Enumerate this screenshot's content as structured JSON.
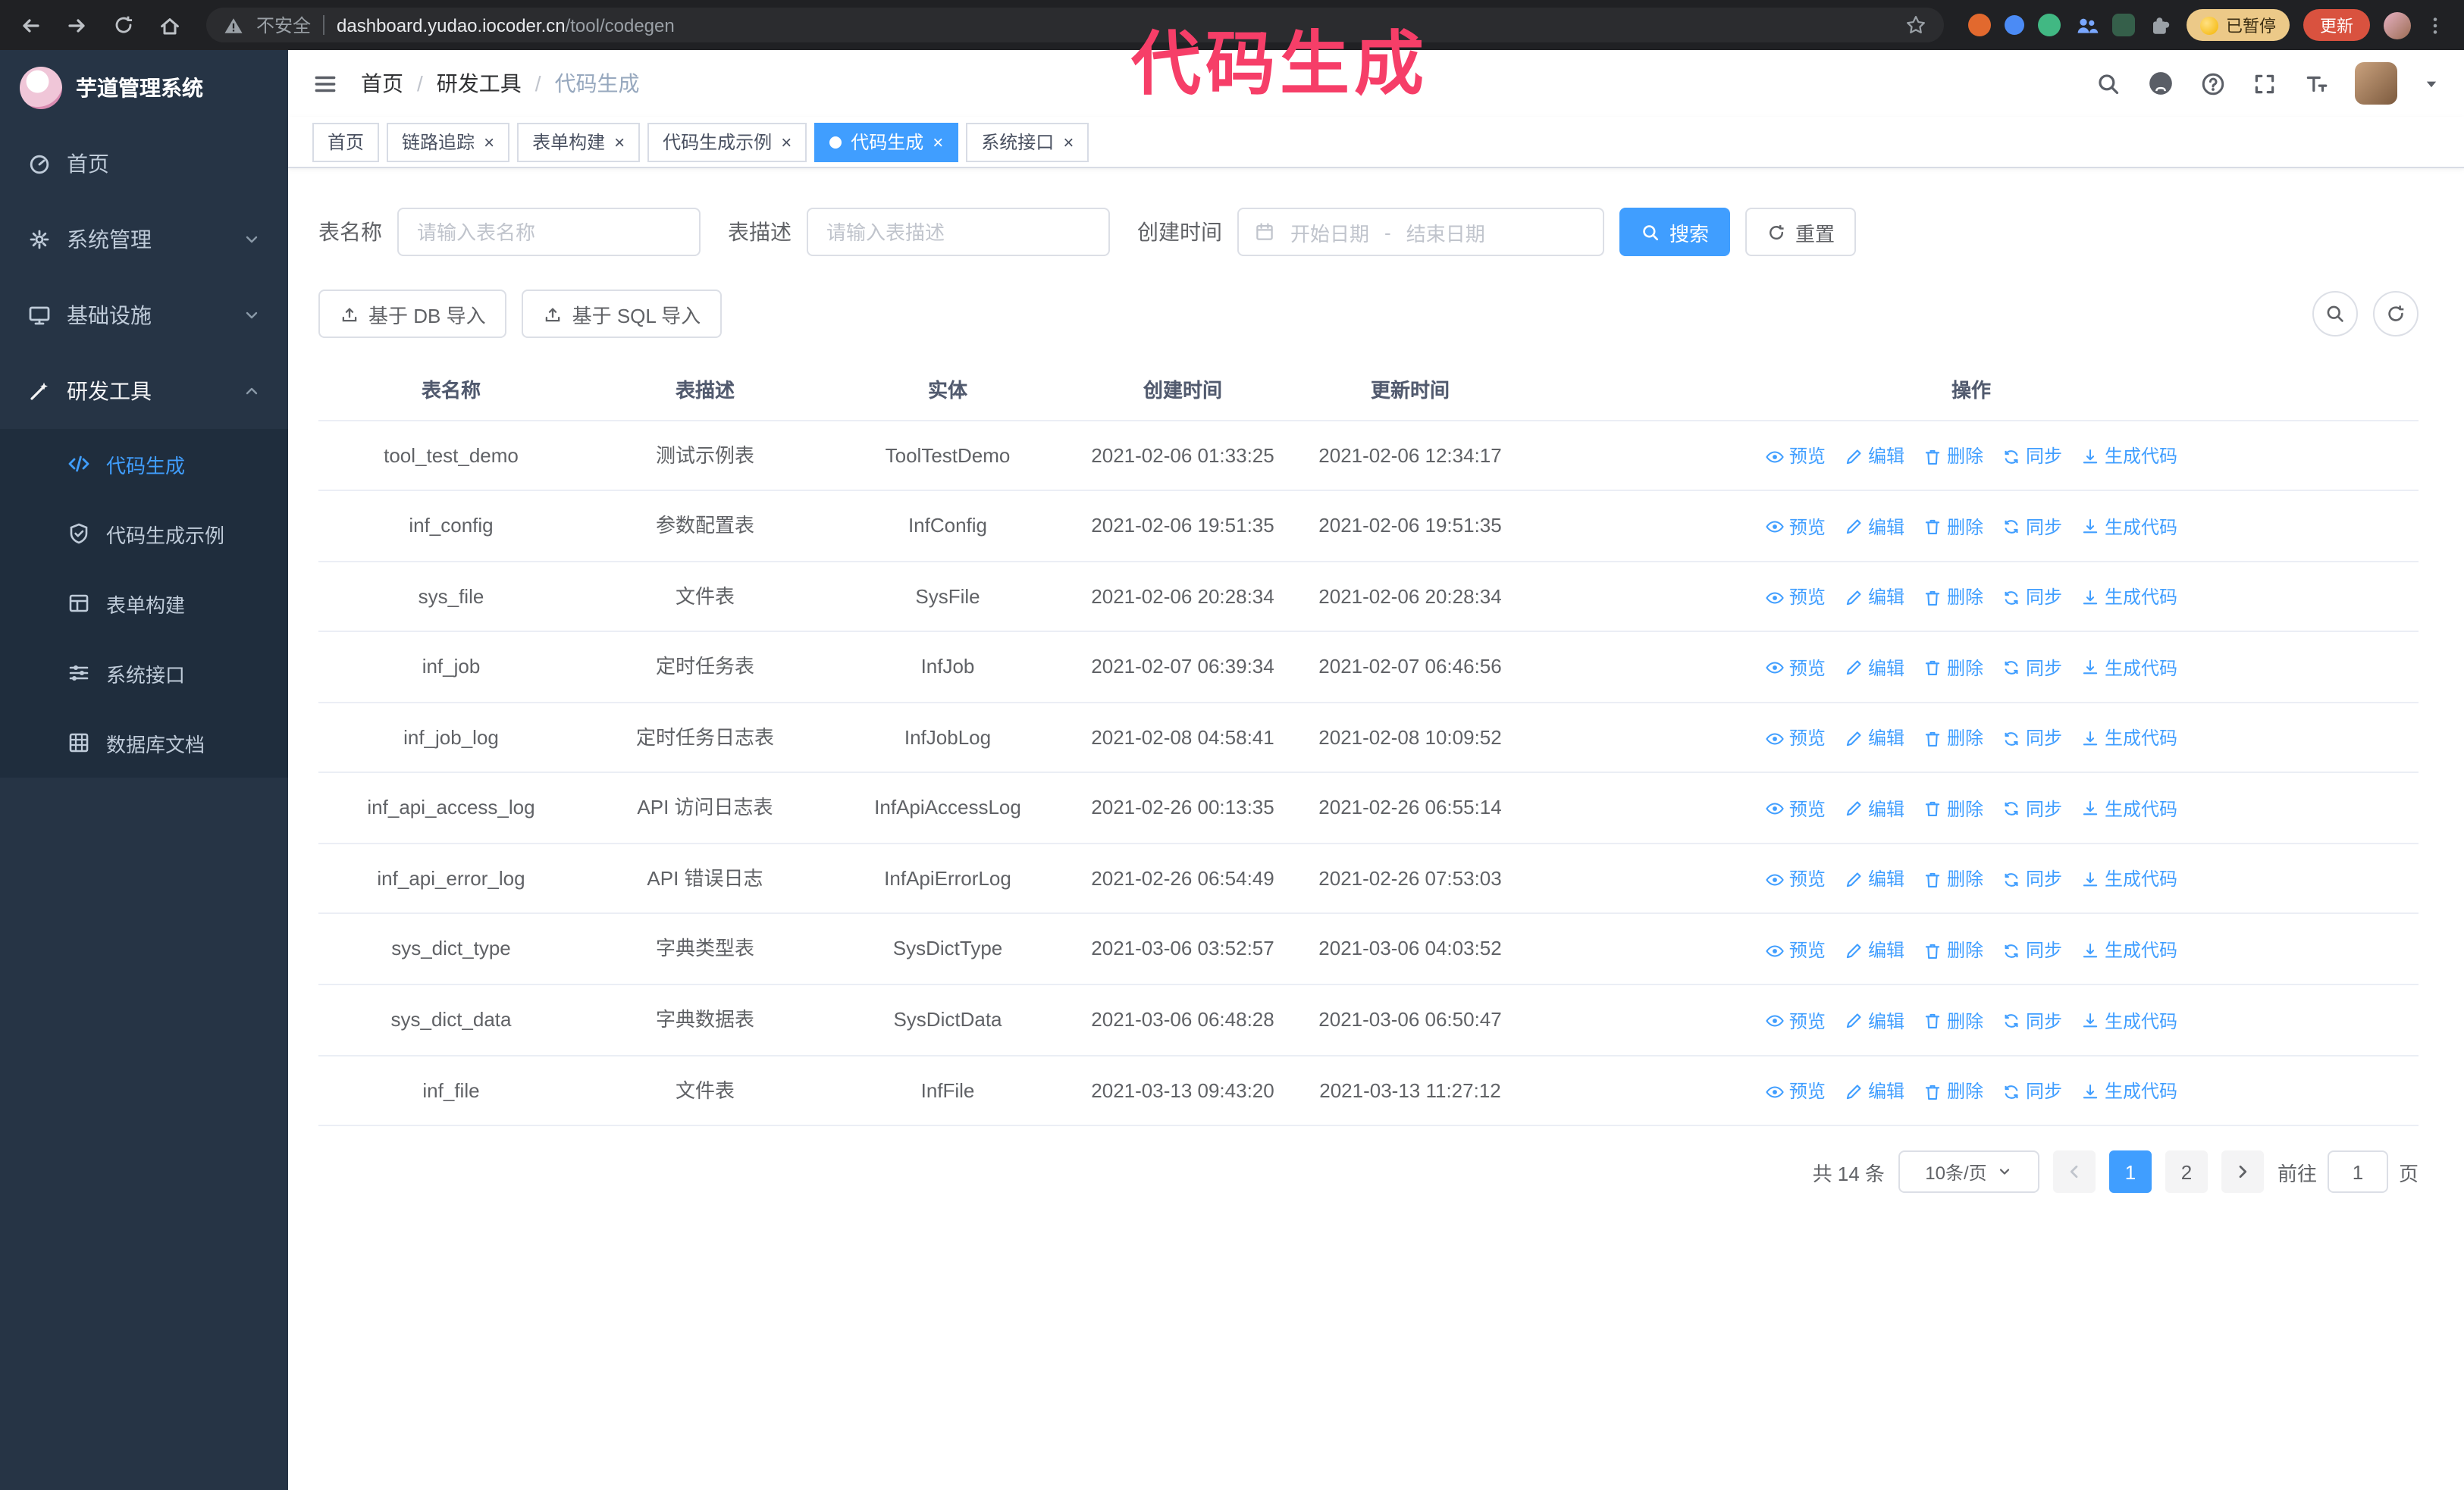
{
  "annotation": {
    "text": "代码生成"
  },
  "browser": {
    "security_label": "不安全",
    "url_domain": "dashboard.yudao.iocoder.cn",
    "url_path": "/tool/codegen",
    "paused_badge": "已暂停",
    "update_button": "更新"
  },
  "sidebar": {
    "logo_title": "芋道管理系统",
    "items": [
      {
        "label": "首页",
        "icon": "dashboard-icon",
        "expandable": false
      },
      {
        "label": "系统管理",
        "icon": "gear-icon",
        "expandable": true,
        "expanded": false
      },
      {
        "label": "基础设施",
        "icon": "monitor-icon",
        "expandable": true,
        "expanded": false
      },
      {
        "label": "研发工具",
        "icon": "tool-icon",
        "expandable": true,
        "expanded": true
      }
    ],
    "submenu": [
      {
        "label": "代码生成",
        "icon": "code-icon",
        "active": true
      },
      {
        "label": "代码生成示例",
        "icon": "shield-icon",
        "active": false
      },
      {
        "label": "表单构建",
        "icon": "form-icon",
        "active": false
      },
      {
        "label": "系统接口",
        "icon": "api-icon",
        "active": false
      },
      {
        "label": "数据库文档",
        "icon": "database-icon",
        "active": false
      }
    ]
  },
  "header": {
    "breadcrumb": [
      "首页",
      "研发工具",
      "代码生成"
    ],
    "separator": "/"
  },
  "tabs": [
    {
      "label": "首页",
      "closable": false,
      "active": false
    },
    {
      "label": "链路追踪",
      "closable": true,
      "active": false
    },
    {
      "label": "表单构建",
      "closable": true,
      "active": false
    },
    {
      "label": "代码生成示例",
      "closable": true,
      "active": false
    },
    {
      "label": "代码生成",
      "closable": true,
      "active": true
    },
    {
      "label": "系统接口",
      "closable": true,
      "active": false
    }
  ],
  "filter": {
    "table_name_label": "表名称",
    "table_name_placeholder": "请输入表名称",
    "table_desc_label": "表描述",
    "table_desc_placeholder": "请输入表描述",
    "create_time_label": "创建时间",
    "date_start_placeholder": "开始日期",
    "date_range_separator": "-",
    "date_end_placeholder": "结束日期",
    "search_label": "搜索",
    "reset_label": "重置"
  },
  "toolbar": {
    "import_db_label": "基于 DB 导入",
    "import_sql_label": "基于 SQL 导入"
  },
  "table": {
    "headers": [
      "表名称",
      "表描述",
      "实体",
      "创建时间",
      "更新时间",
      "操作"
    ],
    "actions": [
      "预览",
      "编辑",
      "删除",
      "同步",
      "生成代码"
    ],
    "rows": [
      {
        "name": "tool_test_demo",
        "desc": "测试示例表",
        "entity": "ToolTestDemo",
        "created": "2021-02-06 01:33:25",
        "updated": "2021-02-06 12:34:17"
      },
      {
        "name": "inf_config",
        "desc": "参数配置表",
        "entity": "InfConfig",
        "created": "2021-02-06 19:51:35",
        "updated": "2021-02-06 19:51:35"
      },
      {
        "name": "sys_file",
        "desc": "文件表",
        "entity": "SysFile",
        "created": "2021-02-06 20:28:34",
        "updated": "2021-02-06 20:28:34"
      },
      {
        "name": "inf_job",
        "desc": "定时任务表",
        "entity": "InfJob",
        "created": "2021-02-07 06:39:34",
        "updated": "2021-02-07 06:46:56"
      },
      {
        "name": "inf_job_log",
        "desc": "定时任务日志表",
        "entity": "InfJobLog",
        "created": "2021-02-08 04:58:41",
        "updated": "2021-02-08 10:09:52"
      },
      {
        "name": "inf_api_access_log",
        "desc": "API 访问日志表",
        "entity": "InfApiAccessLog",
        "created": "2021-02-26 00:13:35",
        "updated": "2021-02-26 06:55:14"
      },
      {
        "name": "inf_api_error_log",
        "desc": "API 错误日志",
        "entity": "InfApiErrorLog",
        "created": "2021-02-26 06:54:49",
        "updated": "2021-02-26 07:53:03"
      },
      {
        "name": "sys_dict_type",
        "desc": "字典类型表",
        "entity": "SysDictType",
        "created": "2021-03-06 03:52:57",
        "updated": "2021-03-06 04:03:52"
      },
      {
        "name": "sys_dict_data",
        "desc": "字典数据表",
        "entity": "SysDictData",
        "created": "2021-03-06 06:48:28",
        "updated": "2021-03-06 06:50:47"
      },
      {
        "name": "inf_file",
        "desc": "文件表",
        "entity": "InfFile",
        "created": "2021-03-13 09:43:20",
        "updated": "2021-03-13 11:27:12"
      }
    ]
  },
  "pagination": {
    "total_text": "共 14 条",
    "page_size_value": "10条/页",
    "pages": [
      "1",
      "2"
    ],
    "active_page": "1",
    "goto_label": "前往",
    "goto_value": "1",
    "goto_unit": "页"
  },
  "icons": {
    "close_x": "×"
  }
}
